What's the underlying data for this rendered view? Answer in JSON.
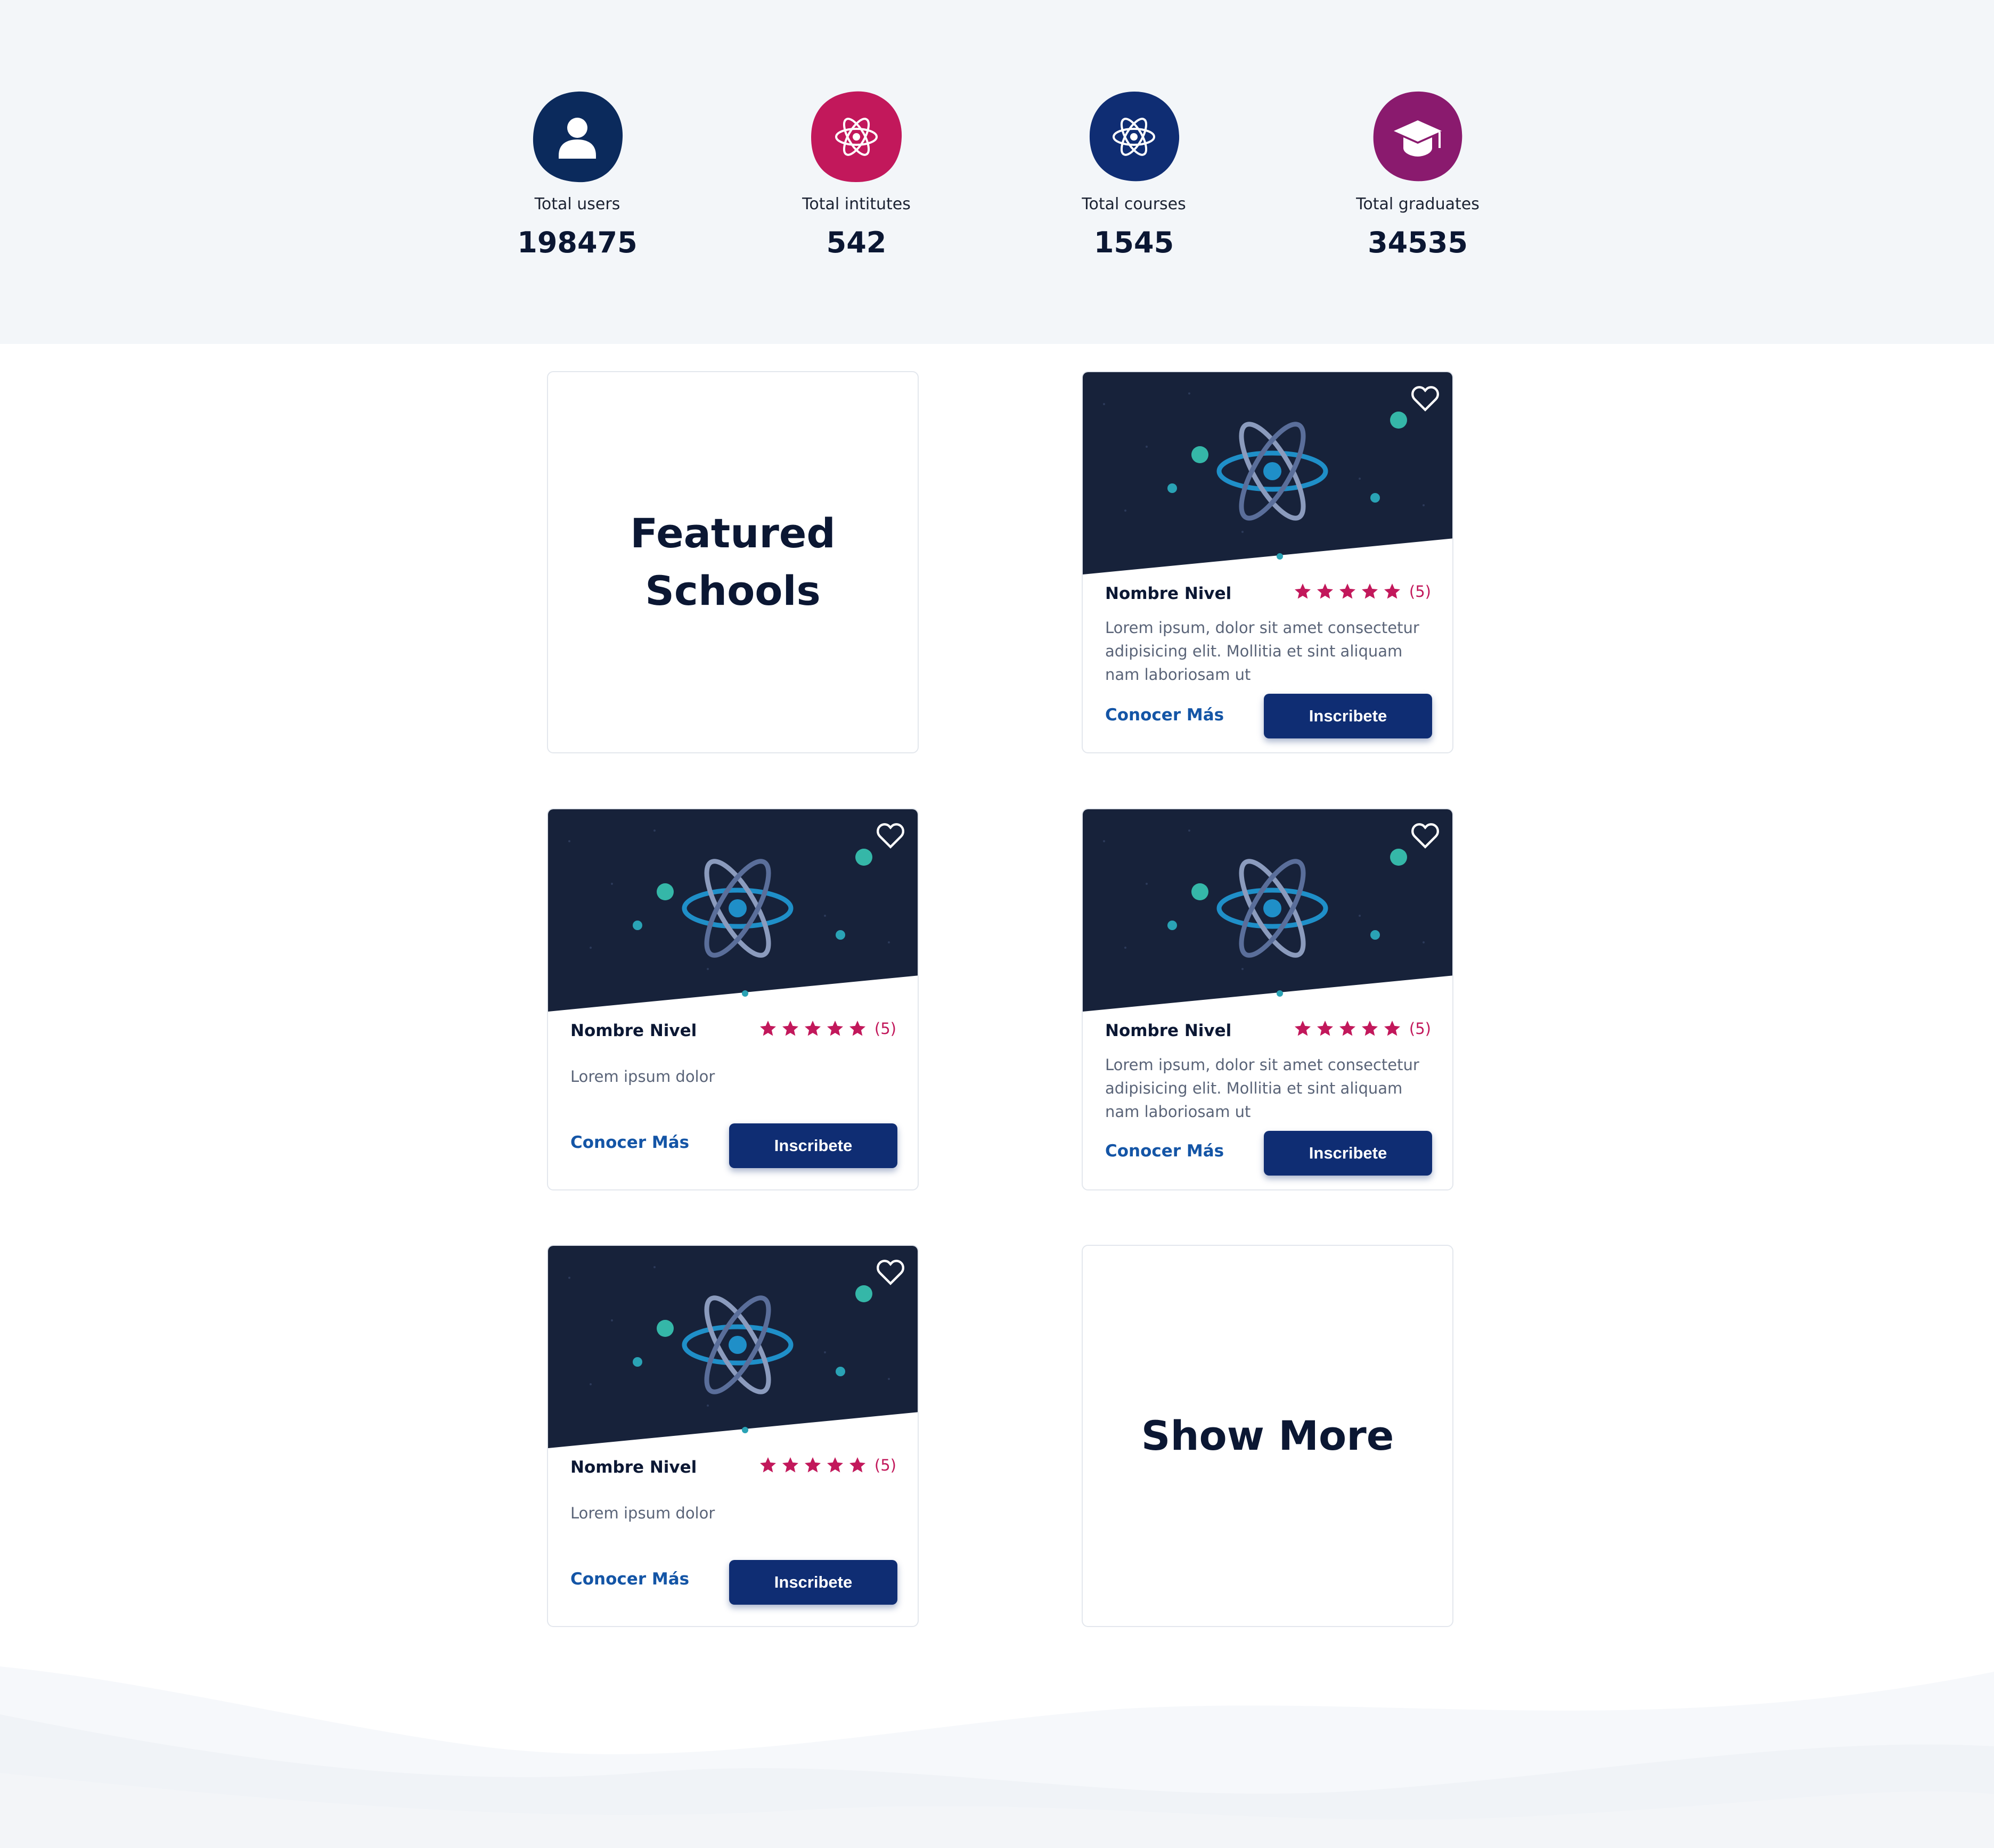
{
  "stats": [
    {
      "icon": "user-icon",
      "label": "Total users",
      "value": "198475",
      "color": "#0b2a5c"
    },
    {
      "icon": "atom-icon",
      "label": "Total intitutes",
      "value": "542",
      "color": "#c2185b"
    },
    {
      "icon": "atom-icon",
      "label": "Total courses",
      "value": "1545",
      "color": "#0f2d73"
    },
    {
      "icon": "graduation-cap-icon",
      "label": "Total graduates",
      "value": "34535",
      "color": "#8a1a6e"
    }
  ],
  "featured": {
    "line1": "Featured",
    "line2": "Schools"
  },
  "cards": [
    {
      "title": "Nombre Nivel",
      "rating": 5,
      "count": "(5)",
      "desc": "Lorem ipsum, dolor sit amet consectetur adipisicing elit. Mollitia et sint aliquam nam laboriosam ut",
      "link": "Conocer Más",
      "button": "Inscribete"
    },
    {
      "title": "Nombre Nivel",
      "rating": 5,
      "count": "(5)",
      "desc": "Lorem ipsum dolor",
      "link": "Conocer Más",
      "button": "Inscribete"
    },
    {
      "title": "Nombre Nivel",
      "rating": 5,
      "count": "(5)",
      "desc": "Lorem ipsum, dolor sit amet consectetur adipisicing elit. Mollitia et sint aliquam nam laboriosam ut",
      "link": "Conocer Más",
      "button": "Inscribete"
    },
    {
      "title": "Nombre Nivel",
      "rating": 5,
      "count": "(5)",
      "desc": "Lorem ipsum dolor",
      "link": "Conocer Más",
      "button": "Inscribete"
    }
  ],
  "show_more": "Show More",
  "colors": {
    "accent_pink": "#c2185b",
    "button_navy": "#0f2d73",
    "link_blue": "#1455a6",
    "media_bg": "#17223a",
    "band_bg": "#f3f6f9"
  }
}
